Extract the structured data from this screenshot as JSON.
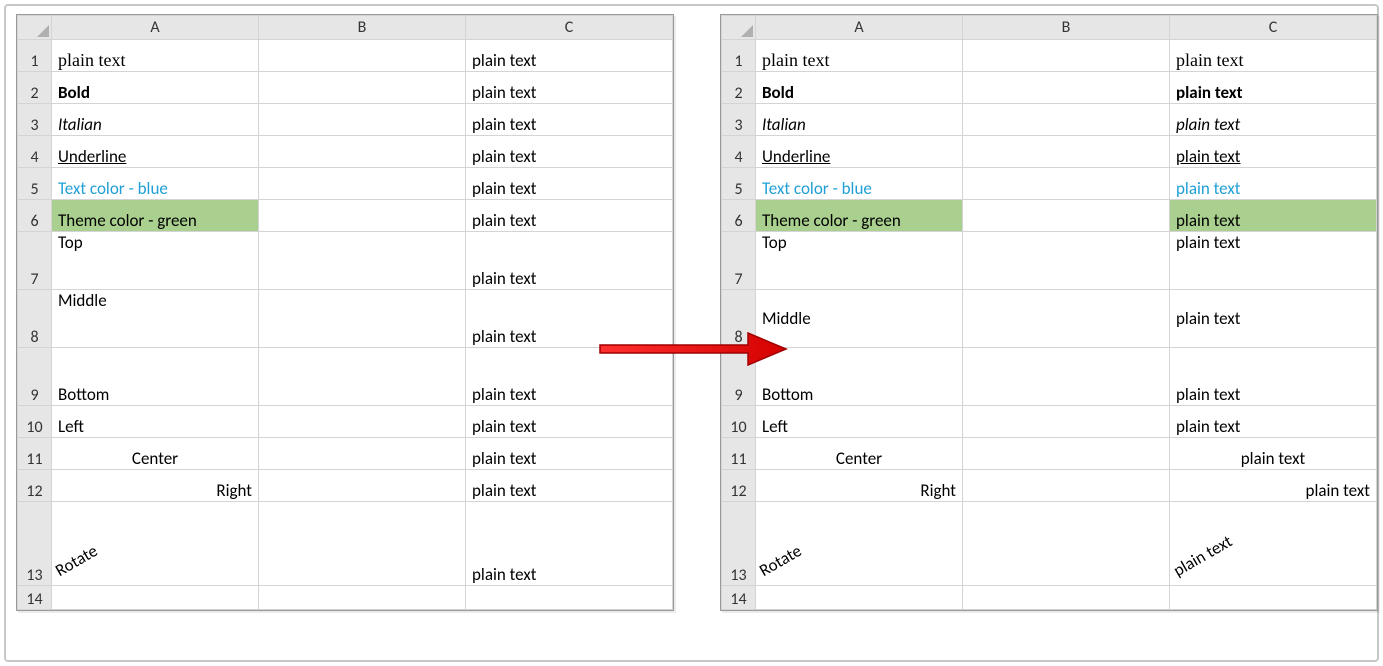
{
  "columns": [
    "A",
    "B",
    "C"
  ],
  "row_numbers": [
    "1",
    "2",
    "3",
    "4",
    "5",
    "6",
    "7",
    "8",
    "9",
    "10",
    "11",
    "12",
    "13",
    "14"
  ],
  "left_sheet": {
    "rows": [
      {
        "A": "plain text",
        "C": "plain text"
      },
      {
        "A": "Bold",
        "C": "plain text"
      },
      {
        "A": "Italian",
        "C": "plain text"
      },
      {
        "A": "Underline",
        "C": "plain text"
      },
      {
        "A": "Text color - blue",
        "C": "plain text"
      },
      {
        "A": "Theme color - green",
        "C": "plain text"
      },
      {
        "A": "Top",
        "C": "plain text"
      },
      {
        "A": "Middle",
        "C": "plain text"
      },
      {
        "A": "Bottom",
        "C": "plain text"
      },
      {
        "A": "Left",
        "C": "plain text"
      },
      {
        "A": "Center",
        "C": "plain text"
      },
      {
        "A": "Right",
        "C": "plain text"
      },
      {
        "A": "Rotate",
        "C": "plain text"
      },
      {
        "A": "",
        "C": ""
      }
    ]
  },
  "right_sheet": {
    "rows": [
      {
        "A": "plain text",
        "C": "plain text"
      },
      {
        "A": "Bold",
        "C": "plain text"
      },
      {
        "A": "Italian",
        "C": "plain text"
      },
      {
        "A": "Underline",
        "C": "plain text"
      },
      {
        "A": "Text color - blue",
        "C": "plain text"
      },
      {
        "A": "Theme color - green",
        "C": "plain text"
      },
      {
        "A": "Top",
        "C": "plain text"
      },
      {
        "A": "Middle",
        "C": "plain text"
      },
      {
        "A": "Bottom",
        "C": "plain text"
      },
      {
        "A": "Left",
        "C": "plain text"
      },
      {
        "A": "Center",
        "C": "plain text"
      },
      {
        "A": "Right",
        "C": "plain text"
      },
      {
        "A": "Rotate",
        "C": "plain text"
      },
      {
        "A": "",
        "C": ""
      }
    ]
  }
}
